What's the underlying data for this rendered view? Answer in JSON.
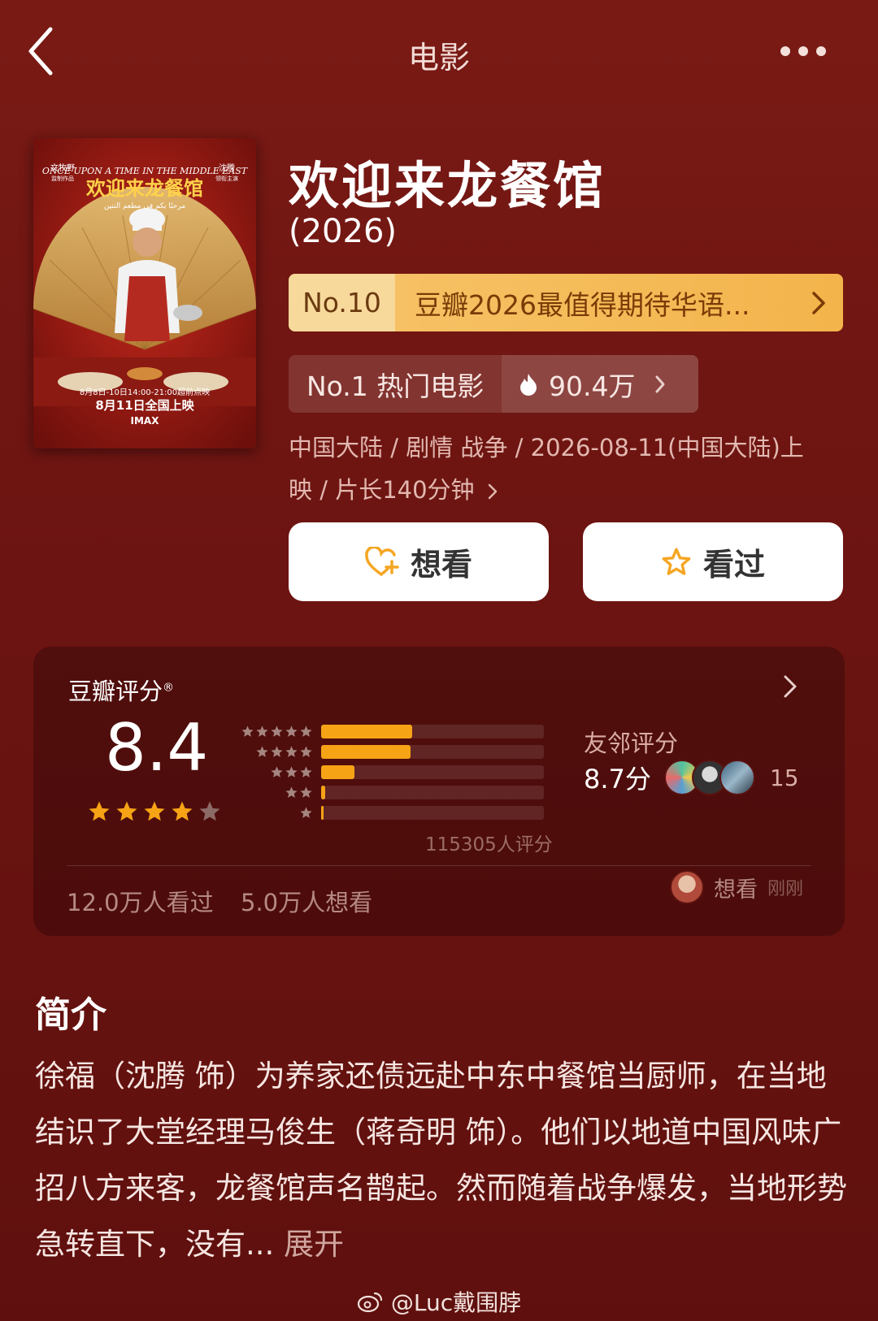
{
  "header": {
    "title": "电影"
  },
  "movie": {
    "title": "欢迎来龙餐馆",
    "year": "(2026)",
    "poster": {
      "tagline": "ONCE UPON A TIME IN THE MIDDLE EAST",
      "title": "欢迎来龙餐馆",
      "arabic": "مرحبًا بكم في مطعم التنين",
      "left_credit": "文牧野",
      "left_credit_sub": "监制作品",
      "right_credit": "沈腾",
      "right_credit_sub": "领衔主演",
      "preview": "8月8日-10日14:00-21:00超前点映",
      "release": "8月11日全国上映",
      "imax": "IMAX"
    }
  },
  "rank": {
    "number": "No.10",
    "text": "豆瓣2026最值得期待华语..."
  },
  "hot": {
    "rank": "No.1 热门电影",
    "count": "90.4万"
  },
  "meta": "中国大陆 / 剧情 战争 / 2026-08-11(中国大陆)上映 / 片长140分钟",
  "actions": {
    "want": "想看",
    "seen": "看过"
  },
  "rating": {
    "label": "豆瓣评分",
    "registered": "®",
    "score": "8.4",
    "stars_value": 4,
    "distribution": [
      {
        "stars": 5,
        "fraction": 0.41
      },
      {
        "stars": 4,
        "fraction": 0.4
      },
      {
        "stars": 3,
        "fraction": 0.15
      },
      {
        "stars": 2,
        "fraction": 0.02
      },
      {
        "stars": 1,
        "fraction": 0.01
      }
    ],
    "count_text": "115305人评分",
    "friends_label": "友邻评分",
    "friends_score": "8.7分",
    "friends_count": "15",
    "seen_count": "12.0万人看过",
    "want_count": "5.0万人想看",
    "recent_action": "想看",
    "recent_time": "刚刚"
  },
  "synopsis": {
    "title": "简介",
    "text": "徐福（沈腾 饰）为养家还债远赴中东中餐馆当厨师，在当地结识了大堂经理马俊生（蒋奇明 饰）。他们以地道中国风味广招八方来客，龙餐馆声名鹊起。然而随着战争爆发，当地形势急转直下，没有...",
    "expand": "展开"
  },
  "watermark": "@Luc戴围脖",
  "colors": {
    "accent": "#f7a316",
    "background": "#6e1512",
    "rank_bar": "#f3b44b"
  }
}
